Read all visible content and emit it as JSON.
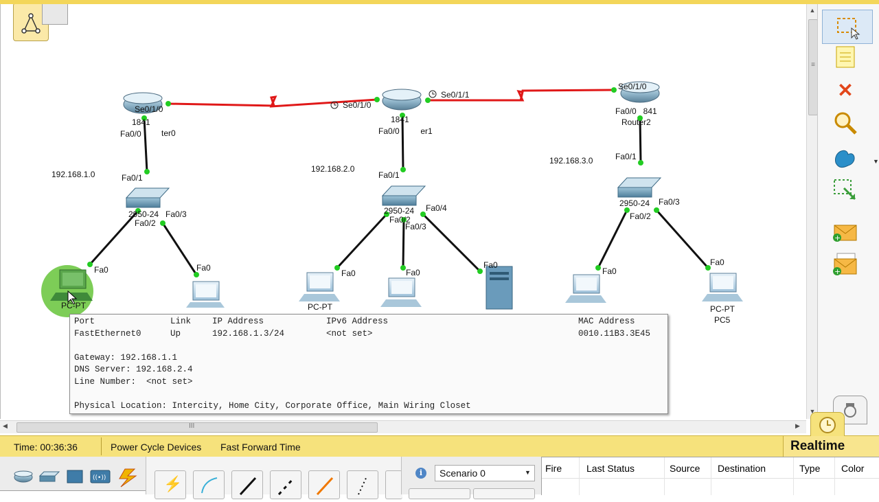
{
  "canvas": {
    "routers": [
      {
        "model": "1841",
        "label": "Router0",
        "serial_port": "Se0/1/0",
        "fast_port": "Fa0/0"
      },
      {
        "model": "1841",
        "label": "Router1",
        "serial_port": "Se0/1/0",
        "serial_port2": "Se0/1/1",
        "fast_port": "Fa0/0"
      },
      {
        "model": "1841",
        "label": "Router2",
        "serial_port": "Se0/1/0",
        "fast_port": "Fa0/0"
      }
    ],
    "networks": [
      "192.168.1.0",
      "192.168.2.0",
      "192.168.3.0"
    ],
    "switches": [
      {
        "model": "2950-24",
        "uplink": "Fa0/1",
        "ports": [
          "Fa0/2",
          "Fa0/3"
        ]
      },
      {
        "model": "2950-24",
        "uplink": "Fa0/1",
        "ports": [
          "Fa0/2",
          "Fa0/3",
          "Fa0/4"
        ]
      },
      {
        "model": "2950-24",
        "uplink": "Fa0/1",
        "ports": [
          "Fa0/2",
          "Fa0/3"
        ]
      }
    ],
    "end_devices": [
      {
        "type": "PC-PT",
        "port": "Fa0"
      },
      {
        "type": "PC-PT",
        "port": "Fa0"
      },
      {
        "type": "PC-PT",
        "port": "Fa0"
      },
      {
        "type": "PC-PT",
        "port": "Fa0"
      },
      {
        "type": "Server-PT",
        "port": "Fa0"
      },
      {
        "type": "PC-PT",
        "port": "Fa0"
      },
      {
        "type": "PC-PT",
        "name": "PC5",
        "port": "Fa0"
      }
    ]
  },
  "tooltip": {
    "headers": {
      "port": "Port",
      "link": "Link",
      "ip": "IP Address",
      "ipv6": "IPv6 Address",
      "mac": "MAC Address"
    },
    "values": {
      "port": "FastEthernet0",
      "link": "Up",
      "ip": "192.168.1.3/24",
      "ipv6": "<not set>",
      "mac": "0010.11B3.3E45"
    },
    "gateway": "Gateway: 192.168.1.1",
    "dns": "DNS Server: 192.168.2.4",
    "line_number": "Line Number:  <not set>",
    "location": "Physical Location: Intercity, Home City, Corporate Office, Main Wiring Closet"
  },
  "statusbar": {
    "time": "Time: 00:36:36",
    "power_cycle": "Power Cycle Devices",
    "fast_forward": "Fast Forward Time",
    "mode": "Realtime"
  },
  "scenario": {
    "selected": "Scenario 0"
  },
  "pdu_table": {
    "columns": [
      "Fire",
      "Last Status",
      "Source",
      "Destination",
      "Type",
      "Color"
    ]
  },
  "scrollbar": {
    "grip": "III",
    "vgrip": "≡"
  },
  "colors": {
    "serial_link": "#e01818",
    "port_up": "#22cc22",
    "status_bar": "#f6e27c",
    "highlight": "#66c43a"
  },
  "icons": [
    "logical-workspace-icon",
    "select-tool-icon",
    "note-tool-icon",
    "delete-tool-icon",
    "inspect-tool-icon",
    "draw-shape-tool-icon",
    "resize-tool-icon",
    "add-simple-pdu-icon",
    "add-complex-pdu-icon",
    "realtime-clock-icon"
  ]
}
